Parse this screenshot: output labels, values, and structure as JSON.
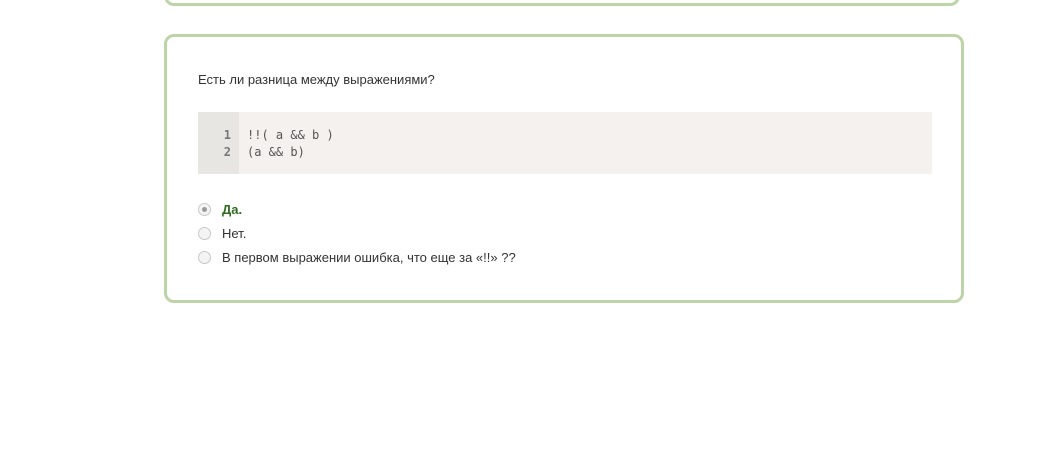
{
  "quiz": {
    "question": "Есть ли разница между выражениями?",
    "code": {
      "line_numbers": [
        "1",
        "2"
      ],
      "lines": [
        "!!( a && b )",
        "(a && b)"
      ]
    },
    "options": [
      {
        "label": "Да.",
        "selected": true,
        "correct": true
      },
      {
        "label": "Нет.",
        "selected": false,
        "correct": false
      },
      {
        "label": "В первом выражении ошибка, что еще за «!!» ??",
        "selected": false,
        "correct": false
      }
    ],
    "colors": {
      "card_border": "#bcd4a8",
      "correct_text": "#2e6b1f",
      "code_bg": "#f4f1ee"
    }
  }
}
